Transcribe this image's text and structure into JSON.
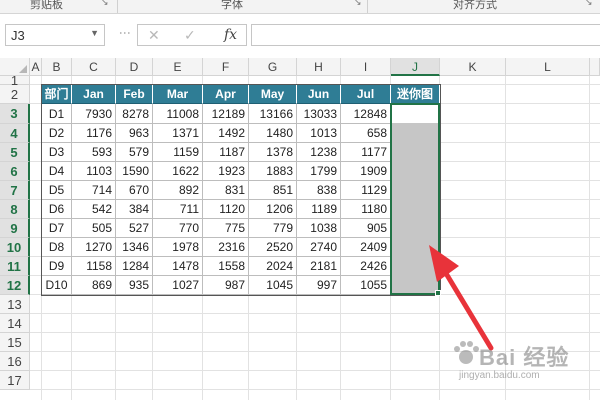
{
  "ribbon": {
    "groups": [
      "剪贴板",
      "字体",
      "对齐方式"
    ],
    "launcher_icon": "dialog-launcher-icon"
  },
  "formula_bar": {
    "name_box": "J3",
    "cancel_icon": "close-icon",
    "enter_icon": "check-icon",
    "fx_label": "fx",
    "content": ""
  },
  "sheet": {
    "columns": [
      "A",
      "B",
      "C",
      "D",
      "E",
      "F",
      "G",
      "H",
      "I",
      "J",
      "K",
      "L"
    ],
    "selected_column": "J",
    "rows": [
      "1",
      "2",
      "3",
      "4",
      "5",
      "6",
      "7",
      "8",
      "9",
      "10",
      "11",
      "12",
      "13",
      "14",
      "15",
      "16",
      "17"
    ],
    "selected_rows": [
      "3",
      "4",
      "5",
      "6",
      "7",
      "8",
      "9",
      "10",
      "11",
      "12"
    ],
    "active_cell": "J3",
    "selection_range": "J3:J12"
  },
  "table": {
    "headers": [
      "部门",
      "Jan",
      "Feb",
      "Mar",
      "Apr",
      "May",
      "Jun",
      "Jul",
      "迷你图"
    ],
    "rows": [
      [
        "D1",
        "7930",
        "8278",
        "11008",
        "12189",
        "13166",
        "13033",
        "12848"
      ],
      [
        "D2",
        "1176",
        "963",
        "1371",
        "1492",
        "1480",
        "1013",
        "658"
      ],
      [
        "D3",
        "593",
        "579",
        "1159",
        "1187",
        "1378",
        "1238",
        "1177"
      ],
      [
        "D4",
        "1103",
        "1590",
        "1622",
        "1923",
        "1883",
        "1799",
        "1909"
      ],
      [
        "D5",
        "714",
        "670",
        "892",
        "831",
        "851",
        "838",
        "1129"
      ],
      [
        "D6",
        "542",
        "384",
        "711",
        "1120",
        "1206",
        "1189",
        "1180"
      ],
      [
        "D7",
        "505",
        "527",
        "770",
        "775",
        "779",
        "1038",
        "905"
      ],
      [
        "D8",
        "1270",
        "1346",
        "1978",
        "2316",
        "2520",
        "2740",
        "2409"
      ],
      [
        "D9",
        "1158",
        "1284",
        "1478",
        "1558",
        "2024",
        "2181",
        "2426"
      ],
      [
        "D10",
        "869",
        "935",
        "1027",
        "987",
        "1045",
        "997",
        "1055"
      ]
    ]
  },
  "colors": {
    "header_fill": "#2f7d95",
    "selection_border": "#217346",
    "selection_fill": "#c6c6c6",
    "arrow": "#e8333a"
  },
  "watermark": {
    "text": "Bai 经验",
    "url": "jingyan.baidu.com"
  }
}
